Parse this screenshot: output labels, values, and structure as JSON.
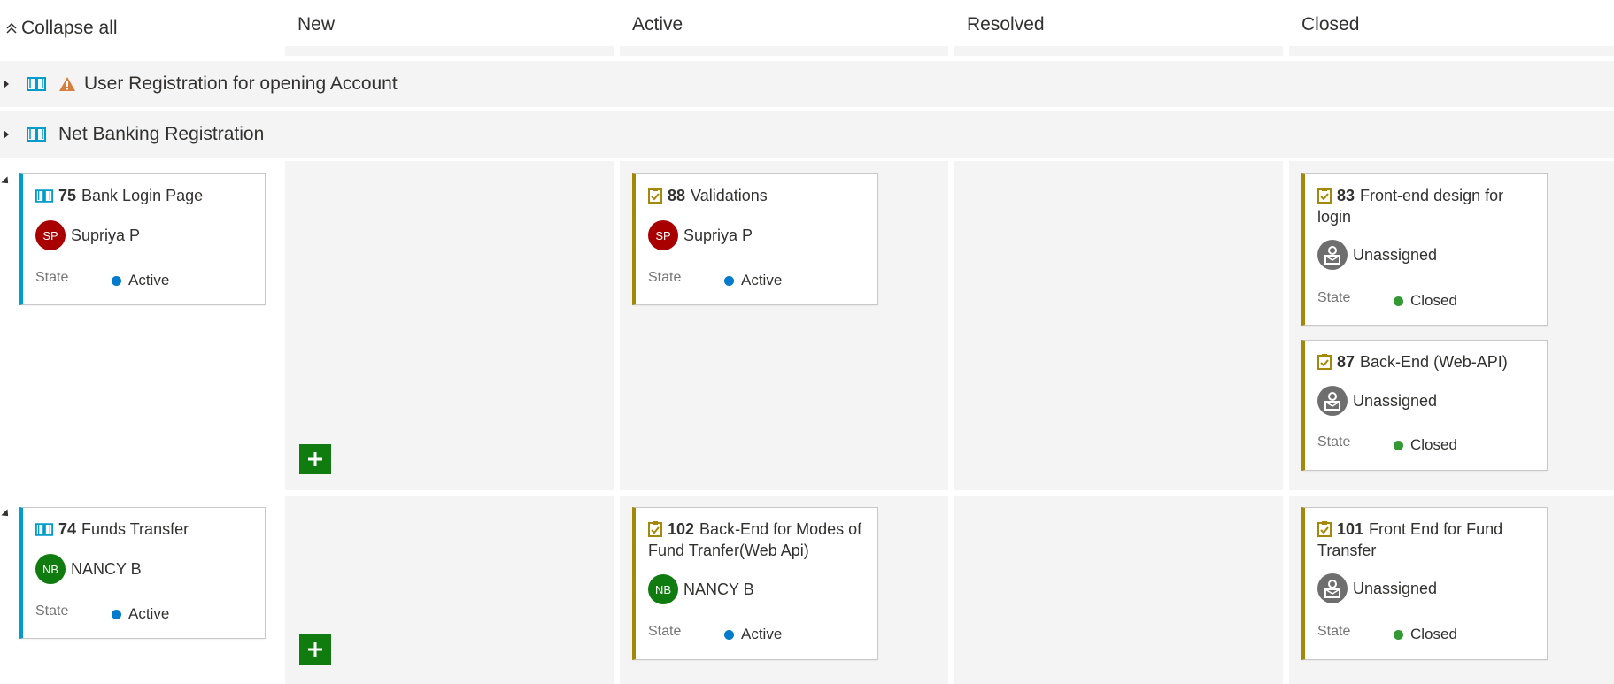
{
  "header": {
    "collapse_all": "Collapse all",
    "columns": [
      "New",
      "Active",
      "Resolved",
      "Closed"
    ]
  },
  "groups": [
    {
      "title": "User Registration for opening Account",
      "warning": true
    },
    {
      "title": "Net Banking Registration",
      "warning": false
    }
  ],
  "lanes": [
    {
      "parent": {
        "id": "75",
        "title": "Bank Login Page",
        "assignee": "Supriya P",
        "initials": "SP",
        "state_label": "State",
        "state": "Active"
      },
      "active": [
        {
          "id": "88",
          "title": "Validations",
          "assignee": "Supriya P",
          "initials": "SP",
          "state_label": "State",
          "state": "Active"
        }
      ],
      "closed": [
        {
          "id": "83",
          "title": "Front-end design for login",
          "assignee": "Unassigned",
          "state_label": "State",
          "state": "Closed"
        },
        {
          "id": "87",
          "title": "Back-End (Web-API)",
          "assignee": "Unassigned",
          "state_label": "State",
          "state": "Closed"
        }
      ]
    },
    {
      "parent": {
        "id": "74",
        "title": "Funds Transfer",
        "assignee": "NANCY B",
        "initials": "NB",
        "state_label": "State",
        "state": "Active"
      },
      "active": [
        {
          "id": "102",
          "title": "Back-End for Modes of Fund Tranfer(Web Api)",
          "assignee": "NANCY B",
          "initials": "NB",
          "state_label": "State",
          "state": "Active"
        }
      ],
      "closed": [
        {
          "id": "101",
          "title": "Front End for Fund Transfer",
          "assignee": "Unassigned",
          "state_label": "State",
          "state": "Closed"
        }
      ]
    }
  ],
  "icons": {
    "collapse": "double-chevron-up-icon",
    "story": "book-icon",
    "task": "clipboard-check-icon",
    "warning": "warning-triangle-icon",
    "add": "plus-icon",
    "unassigned": "unassigned-person-icon"
  },
  "colors": {
    "story_accent": "#009ccc",
    "task_accent": "#a4880a",
    "active_dot": "#007acc",
    "closed_dot": "#339933",
    "add_button": "#107c10",
    "avatar_sp": "#a80000",
    "avatar_nb": "#107c10",
    "warning": "#d67f3c"
  }
}
